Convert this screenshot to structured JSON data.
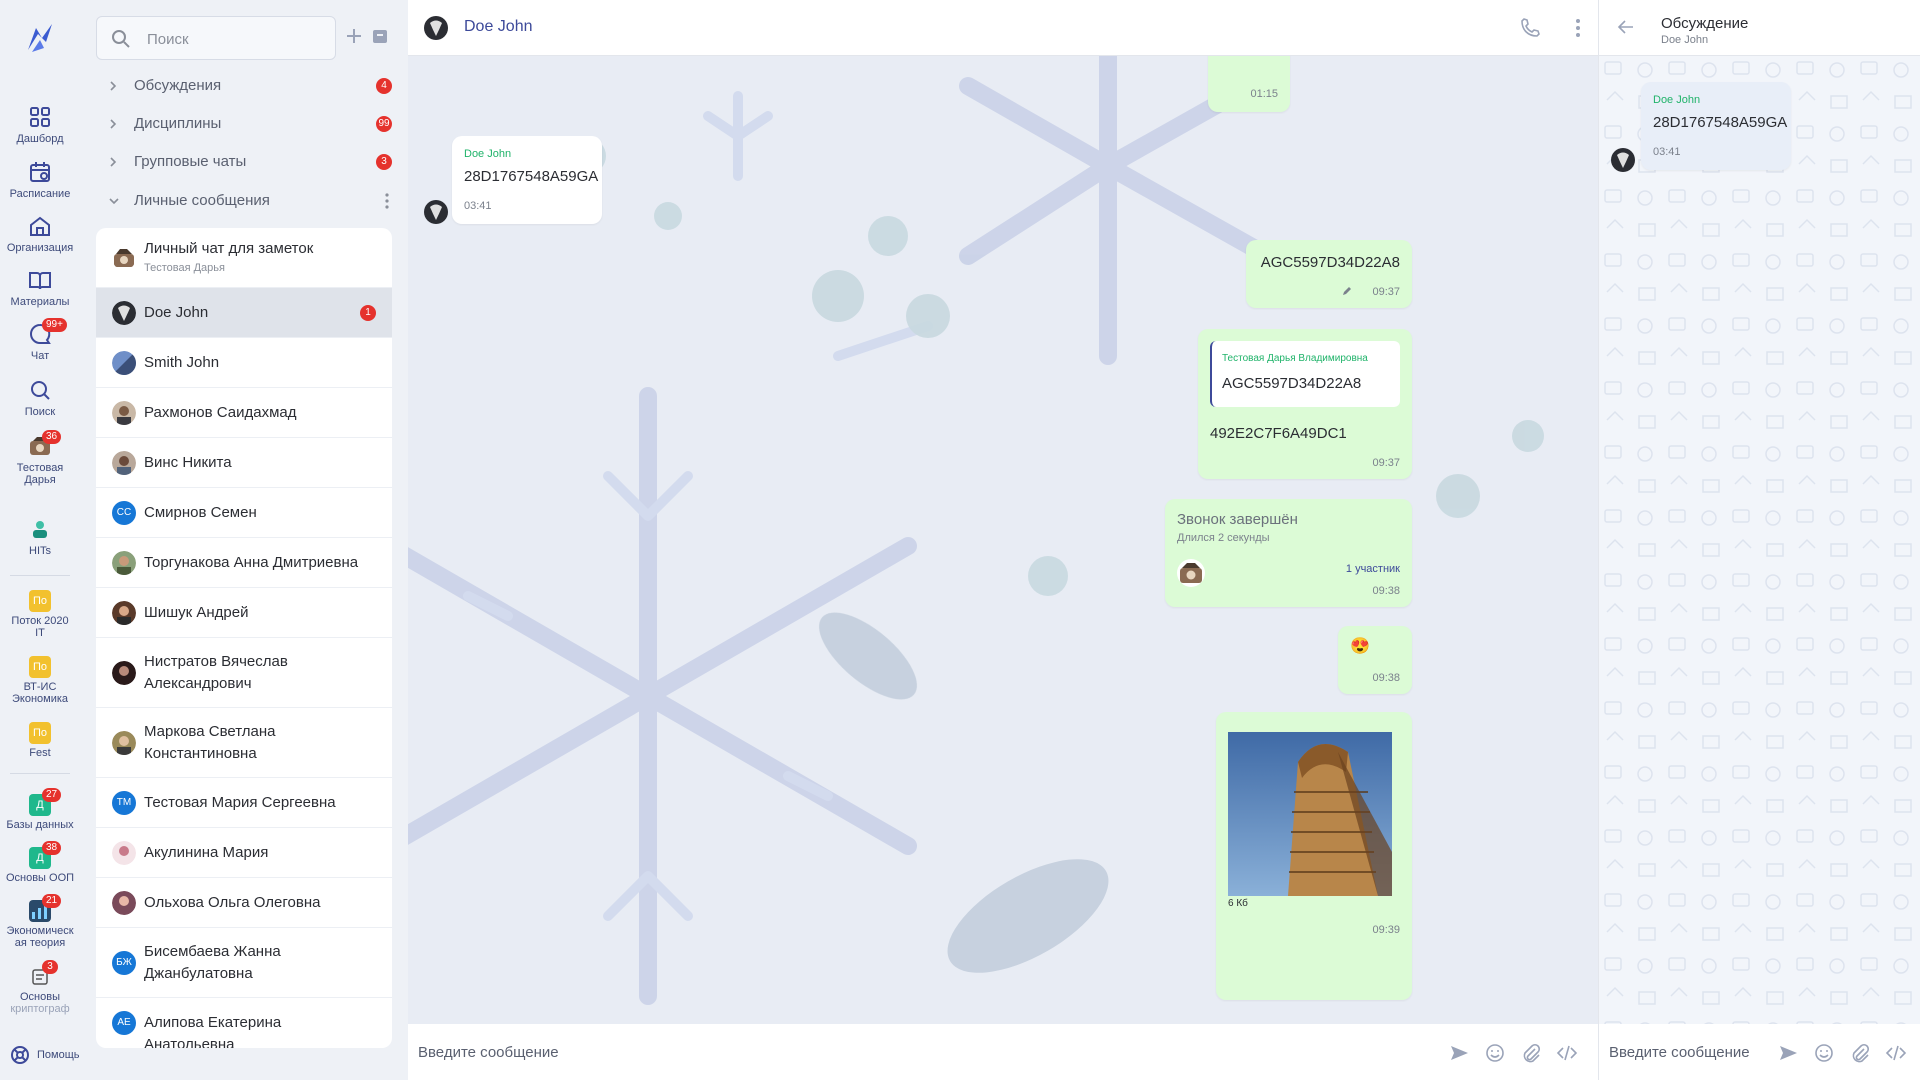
{
  "rail": {
    "items": [
      {
        "label": "Дашборд",
        "icon": "dashboard-icon"
      },
      {
        "label": "Расписание",
        "icon": "calendar-icon"
      },
      {
        "label": "Организация",
        "icon": "organization-icon"
      },
      {
        "label": "Материалы",
        "icon": "book-icon"
      },
      {
        "label": "Чат",
        "icon": "chat-icon",
        "badge": "99+"
      },
      {
        "label": "Поиск",
        "icon": "search-icon"
      },
      {
        "label_line1": "Тестовая",
        "label_line2": "Дарья",
        "badge": "36"
      },
      {
        "label": "HITs"
      },
      {
        "label_line1": "Поток 2020",
        "label_line2": "IT",
        "square": "По"
      },
      {
        "label_line1": "ВТ-ИС",
        "label_line2": "Экономика",
        "square": "По"
      },
      {
        "label": "Fest",
        "square": "По"
      },
      {
        "label": "Базы данных",
        "square": "Д",
        "badge": "27"
      },
      {
        "label": "Основы ООП",
        "square": "Д",
        "badge": "38"
      },
      {
        "label_line1": "Экономическ",
        "label_line2": "ая теория",
        "badge": "21"
      },
      {
        "label_line1": "Основы",
        "label_line2": "криптограф",
        "badge": "3"
      }
    ],
    "help_label": "Помощь"
  },
  "search": {
    "placeholder": "Поиск"
  },
  "folders": [
    {
      "name": "Обсуждения",
      "badge": "4"
    },
    {
      "name": "Дисциплины",
      "badge": "99"
    },
    {
      "name": "Групповые чаты",
      "badge": "3"
    },
    {
      "name": "Личные сообщения"
    }
  ],
  "chats": [
    {
      "name": "Личный чат для заметок",
      "sub": "Тестовая Дарья"
    },
    {
      "name": "Doe John",
      "badge": "1"
    },
    {
      "name": "Smith John"
    },
    {
      "name": "Рахмонов Саидахмад"
    },
    {
      "name": "Винс Никита"
    },
    {
      "name": "Смирнов Семен",
      "initials": "СС"
    },
    {
      "name": "Торгунакова Анна Дмитриевна"
    },
    {
      "name": "Шишук Андрей"
    },
    {
      "name": "Нистратов Вячеслав Александрович"
    },
    {
      "name": "Маркова Светлана Константиновна"
    },
    {
      "name": "Тестовая Мария Сергеевна",
      "initials": "ТМ"
    },
    {
      "name": "Акулинина Мария"
    },
    {
      "name": "Ольхова Ольга Олеговна"
    },
    {
      "name": "Бисембаева Жанна Джанбулатовна",
      "initials": "БЖ"
    },
    {
      "name": "Алипова Екатерина Анатольевна",
      "initials": "АЕ"
    }
  ],
  "header": {
    "title": "Doe John"
  },
  "messages": {
    "m0": {
      "time": "01:15"
    },
    "m1": {
      "author": "Doe John",
      "text": "28D1767548A59GA",
      "time": "03:41"
    },
    "m2": {
      "text": "AGC5597D34D22A8",
      "time": "09:37"
    },
    "m3": {
      "reply_author": "Тестовая Дарья Владимировна",
      "reply_text": "AGC5597D34D22A8",
      "text": "492E2C7F6A49DC1",
      "time": "09:37"
    },
    "m4": {
      "title": "Звонок завершён",
      "duration": "Длился 2 секунды",
      "participants": "1 участник",
      "time": "09:38"
    },
    "m5": {
      "emoji": "😍",
      "time": "09:38"
    },
    "m6": {
      "size": "6 Кб",
      "time": "09:39"
    }
  },
  "composer": {
    "placeholder": "Введите сообщение"
  },
  "thread": {
    "title": "Обсуждение",
    "subtitle": "Doe John",
    "message": {
      "author": "Doe John",
      "text": "28D1767548A59GA",
      "time": "03:41"
    },
    "placeholder": "Введите сообщение"
  },
  "colors": {
    "accent": "#3d4a9a",
    "badge": "#e5322d",
    "outgoing": "#dcfbd6",
    "author": "#20b36a"
  }
}
